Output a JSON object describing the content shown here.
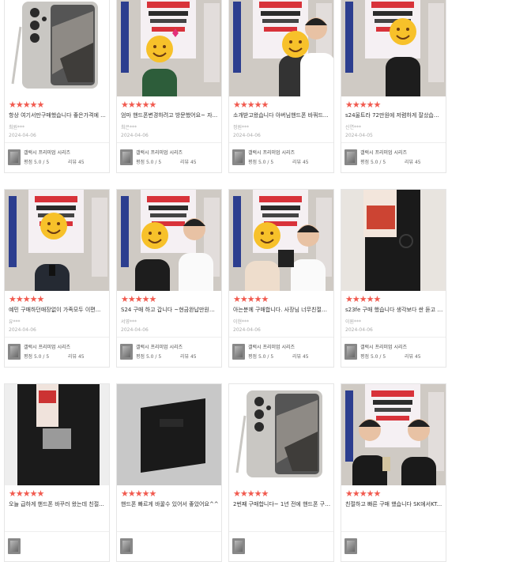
{
  "reviews": [
    {
      "stars": "★★★★★",
      "text": "항상 여기서만구매했습니다 좋은가격에 ...",
      "author": "최원***",
      "date": "2024-04-06",
      "product": "갤럭시 프리미엄 시리즈",
      "rating_label": "평점 5.0 / 5",
      "count_label": "리뷰 45",
      "photo": "phone-product"
    },
    {
      "stars": "★★★★★",
      "text": "엄마 핸드폰변경하려고 방문했어요~ 자...",
      "author": "최은***",
      "date": "2024-04-06",
      "product": "갤럭시 프리미엄 시리즈",
      "rating_label": "평점 5.0 / 5",
      "count_label": "리뷰 45",
      "photo": "customer-in-store"
    },
    {
      "stars": "★★★★★",
      "text": "소개받고왔습니다 아버님핸드폰 바꿔드...",
      "author": "정원***",
      "date": "2024-04-06",
      "product": "갤럭시 프리미엄 시리즈",
      "rating_label": "평점 5.0 / 5",
      "count_label": "리뷰 45",
      "photo": "two-customers"
    },
    {
      "stars": "★★★★★",
      "text": "s24울트라 72만원에 저렴하게 잘샀습니...",
      "author": "신연***",
      "date": "2024-04-05",
      "product": "갤럭시 프리미엄 시리즈",
      "rating_label": "평점 5.0 / 5",
      "count_label": "리뷰 45",
      "photo": "customer-black-shirt"
    },
    {
      "stars": "★★★★★",
      "text": "예민 구매하던매장없이 가족모두 이편...",
      "author": "유***",
      "date": "2024-04-06",
      "product": "갤럭시 프리미엄 시리즈",
      "rating_label": "평점 5.0 / 5",
      "count_label": "리뷰 45",
      "photo": "customer-dark-jacket"
    },
    {
      "stars": "★★★★★",
      "text": "S24 구매 하고 갑니다 ~현금완납만원에...",
      "author": "서영***",
      "date": "2024-04-06",
      "product": "갤럭시 프리미엄 시리즈",
      "rating_label": "평점 5.0 / 5",
      "count_label": "리뷰 45",
      "photo": "customer-with-staff"
    },
    {
      "stars": "★★★★★",
      "text": "아는분께 구매합니다. 사장님 너무친절하...",
      "author": "이현***",
      "date": "2024-04-06",
      "product": "갤럭시 프리미엄 시리즈",
      "rating_label": "평점 5.0 / 5",
      "count_label": "리뷰 45",
      "photo": "customer-with-staff-2"
    },
    {
      "stars": "★★★★★",
      "text": "s23fe 구매 했습니다 생각보다 싼 듣고 와...",
      "author": "이원***",
      "date": "2024-04-06",
      "product": "갤럭시 프리미엄 시리즈",
      "rating_label": "평점 5.0 / 5",
      "count_label": "리뷰 45",
      "photo": "phone-box"
    },
    {
      "stars": "★★★★★",
      "text": "오늘 급하게 핸드폰 바꾸러 왔는데 친절...",
      "author": "",
      "date": "",
      "product": "",
      "rating_label": "",
      "count_label": "",
      "photo": "phone-box-desk"
    },
    {
      "stars": "★★★★★",
      "text": "핸드폰 빠르게 바꿀수 있어서 좋았어요^^",
      "author": "",
      "date": "",
      "product": "",
      "rating_label": "",
      "count_label": "",
      "photo": "black-box"
    },
    {
      "stars": "★★★★★",
      "text": "2번째 구매합니다~ 1년 전에 핸드폰 구매...",
      "author": "",
      "date": "",
      "product": "",
      "rating_label": "",
      "count_label": "",
      "photo": "phone-product"
    },
    {
      "stars": "★★★★★",
      "text": "친절하고 빠른 구매 했습니다 SK에서KT...",
      "author": "",
      "date": "",
      "product": "",
      "rating_label": "",
      "count_label": "",
      "photo": "two-customers-selfie"
    }
  ]
}
